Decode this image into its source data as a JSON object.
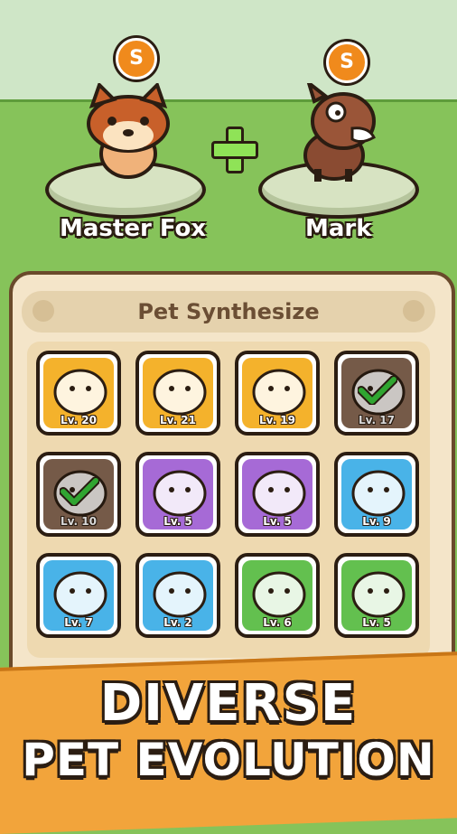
{
  "scene": {
    "colors": {
      "sky": "#cfe6c7",
      "grass": "#86c35a",
      "trees": "#4f8f3f"
    }
  },
  "left_pet": {
    "name": "Master Fox",
    "rank": "S",
    "icon": "raccoon-pet-icon"
  },
  "right_pet": {
    "name": "Mark",
    "rank": "S",
    "icon": "horse-pet-icon"
  },
  "combine_icon": "plus-icon",
  "panel": {
    "title": "Pet Synthesize"
  },
  "pet_cards": [
    {
      "level": "Lv. 20",
      "icon": "pilot-bird-pet-icon",
      "bg": "#f4b22c",
      "selected": false
    },
    {
      "level": "Lv. 21",
      "icon": "fire-pet-icon",
      "bg": "#f4b22c",
      "selected": false
    },
    {
      "level": "Lv. 19",
      "icon": "cloud-pet-icon",
      "bg": "#f4b22c",
      "selected": false
    },
    {
      "level": "Lv. 17",
      "icon": "raccoon-pet-icon",
      "bg": "#8a6a55",
      "selected": true
    },
    {
      "level": "Lv. 10",
      "icon": "raccoon-pet-icon",
      "bg": "#8a6a55",
      "selected": true
    },
    {
      "level": "Lv. 5",
      "icon": "purple-ghost-pet-icon",
      "bg": "#a66ad6",
      "selected": false
    },
    {
      "level": "Lv. 5",
      "icon": "purple-octopus-pet-icon",
      "bg": "#a66ad6",
      "selected": false
    },
    {
      "level": "Lv. 9",
      "icon": "boar-pet-icon",
      "bg": "#49b3e8",
      "selected": false
    },
    {
      "level": "Lv. 7",
      "icon": "chicken-pet-icon",
      "bg": "#49b3e8",
      "selected": false
    },
    {
      "level": "Lv. 2",
      "icon": "pufferfish-pet-icon",
      "bg": "#49b3e8",
      "selected": false
    },
    {
      "level": "Lv. 6",
      "icon": "sprout-pet-icon",
      "bg": "#63c04f",
      "selected": false
    },
    {
      "level": "Lv. 5",
      "icon": "frog-pet-icon",
      "bg": "#63c04f",
      "selected": false
    }
  ],
  "banner": {
    "line1": "DIVERSE",
    "line2": "PET EVOLUTION"
  }
}
